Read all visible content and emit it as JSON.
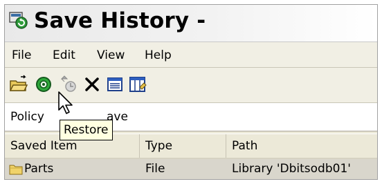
{
  "window": {
    "title": "Save History -"
  },
  "menu": {
    "items": [
      "File",
      "Edit",
      "View",
      "Help"
    ]
  },
  "toolbar": {
    "buttons": [
      {
        "icon": "open-folder-icon",
        "enabled": true
      },
      {
        "icon": "restore-icon",
        "enabled": true
      },
      {
        "icon": "restore-history-icon",
        "enabled": false
      },
      {
        "icon": "delete-icon",
        "enabled": true
      },
      {
        "icon": "properties-icon",
        "enabled": true
      },
      {
        "icon": "columns-icon",
        "enabled": true
      }
    ]
  },
  "filter": {
    "label": "Policy",
    "value": "ave"
  },
  "tooltip": {
    "text": "Restore"
  },
  "table": {
    "columns": [
      "Saved Item",
      "Type",
      "Path"
    ],
    "rows": [
      {
        "name": "Parts",
        "type": "File",
        "path": "Library 'Dbitsodb01'"
      }
    ]
  },
  "colors": {
    "tooltip_bg": "#ffffe1",
    "selected_row": "#d9d6cc",
    "window_bg": "#ece9d8"
  }
}
